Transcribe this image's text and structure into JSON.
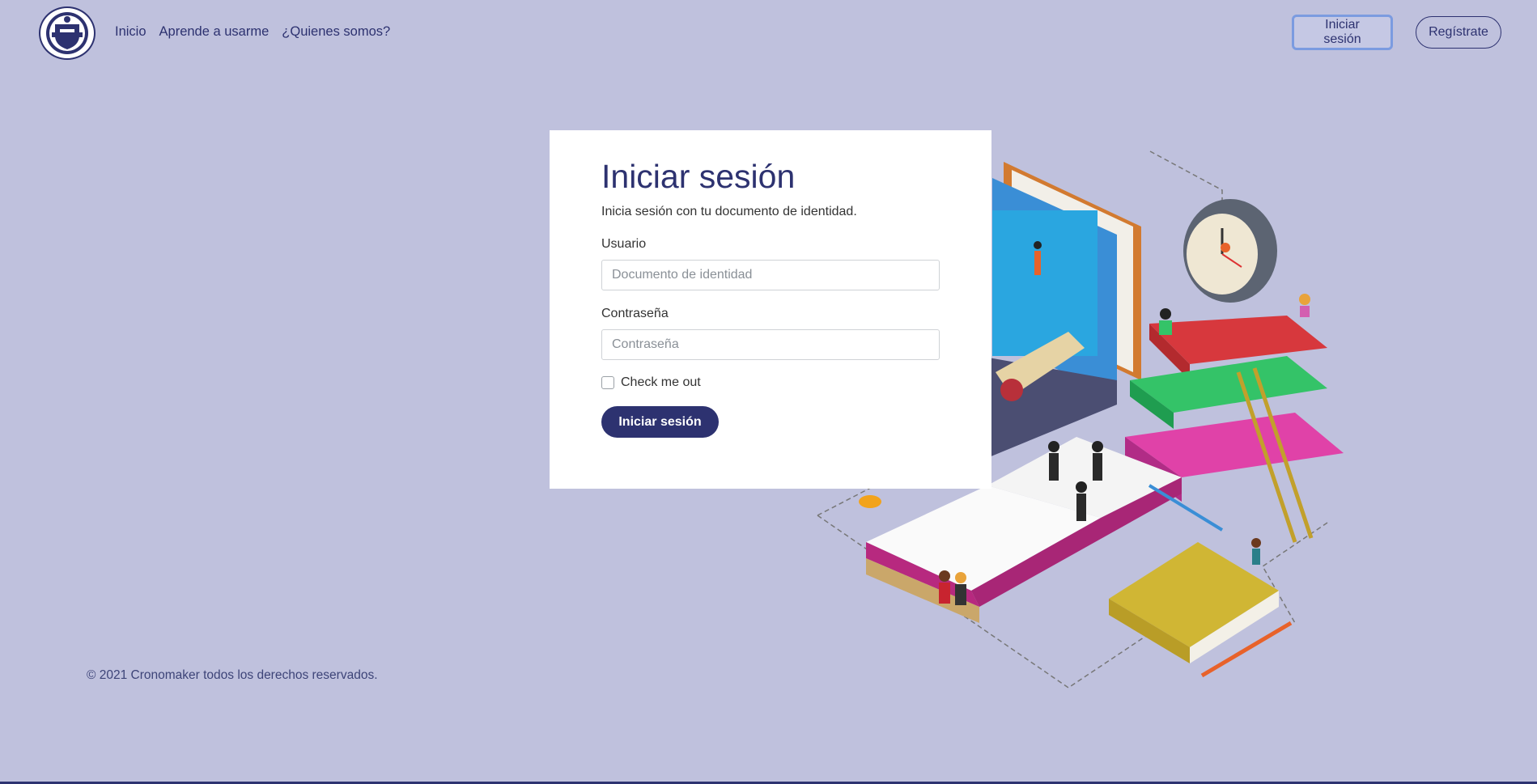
{
  "header": {
    "logo_alt": "logo",
    "nav": [
      {
        "label": "Inicio"
      },
      {
        "label": "Aprende a usarme"
      },
      {
        "label": "¿Quienes somos?"
      }
    ],
    "login_button": "Iniciar sesión",
    "register_button": "Regístrate"
  },
  "login": {
    "title": "Iniciar sesión",
    "subtitle": "Inicia sesión con tu documento de identidad.",
    "user_label": "Usuario",
    "user_placeholder": "Documento de identidad",
    "password_label": "Contraseña",
    "password_placeholder": "Contraseña",
    "remember_label": "Check me out",
    "submit_label": "Iniciar sesión"
  },
  "footer": {
    "text": "© 2021 Cronomaker todos los derechos reservados."
  },
  "colors": {
    "background": "#bfc1dd",
    "primary": "#2d3270",
    "card": "#ffffff"
  }
}
